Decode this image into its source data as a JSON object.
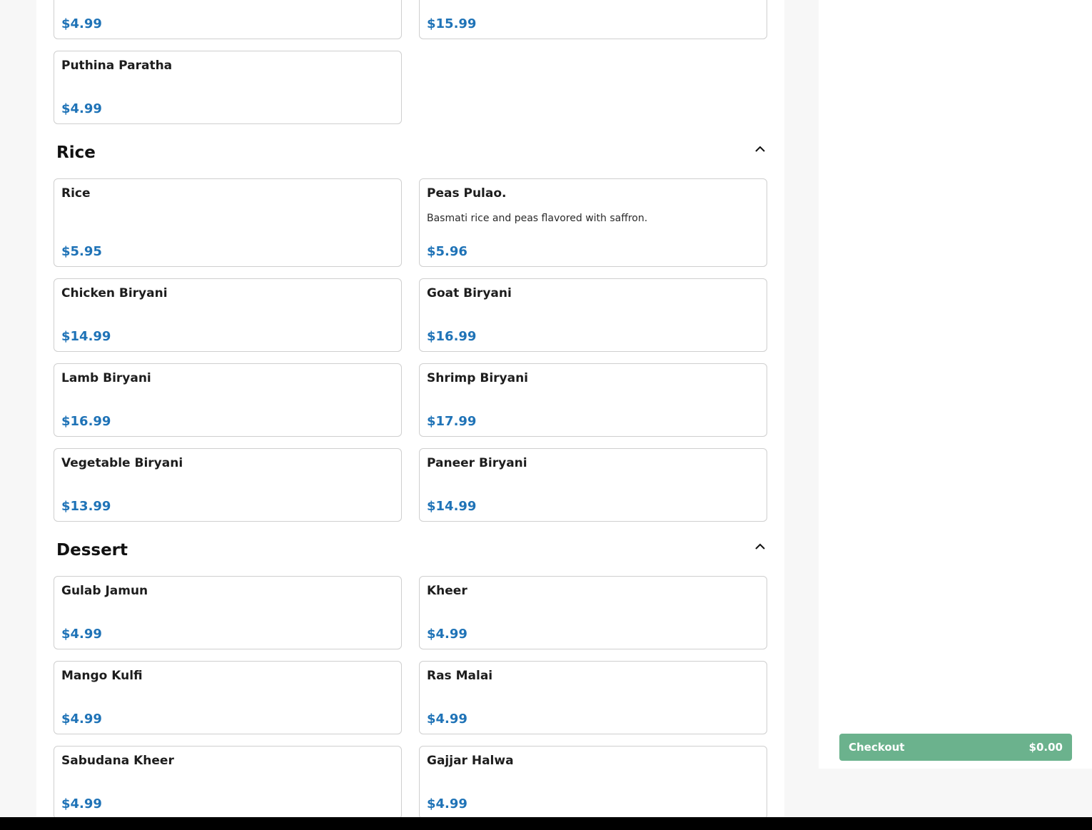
{
  "partial_section": {
    "items": [
      {
        "name": "",
        "price": "$4.99"
      },
      {
        "name": "",
        "price": "$15.99"
      },
      {
        "name": "Puthina Paratha",
        "price": "$4.99"
      }
    ]
  },
  "rice_section": {
    "title": "Rice",
    "collapse_icon": "chevron-up-icon",
    "items": [
      {
        "name": "Rice",
        "price": "$5.95"
      },
      {
        "name": "Peas Pulao.",
        "description": "Basmati rice and peas flavored with saffron.",
        "price": "$5.96"
      },
      {
        "name": "Chicken Biryani",
        "price": "$14.99"
      },
      {
        "name": "Goat Biryani",
        "price": "$16.99"
      },
      {
        "name": "Lamb Biryani",
        "price": "$16.99"
      },
      {
        "name": "Shrimp Biryani",
        "price": "$17.99"
      },
      {
        "name": "Vegetable Biryani",
        "price": "$13.99"
      },
      {
        "name": "Paneer Biryani",
        "price": "$14.99"
      }
    ]
  },
  "dessert_section": {
    "title": "Dessert",
    "collapse_icon": "chevron-up-icon",
    "items": [
      {
        "name": "Gulab Jamun",
        "price": "$4.99"
      },
      {
        "name": "Kheer",
        "price": "$4.99"
      },
      {
        "name": "Mango Kulfi",
        "price": "$4.99"
      },
      {
        "name": "Ras Malai",
        "price": "$4.99"
      },
      {
        "name": "Sabudana Kheer",
        "price": "$4.99"
      },
      {
        "name": "Gajjar Halwa",
        "price": "$4.99"
      }
    ]
  },
  "cart": {
    "checkout_label": "Checkout",
    "total": "$0.00",
    "button_color": "#6bb28d"
  },
  "colors": {
    "price": "#1f73b7",
    "card_border": "#cfcfcf"
  }
}
